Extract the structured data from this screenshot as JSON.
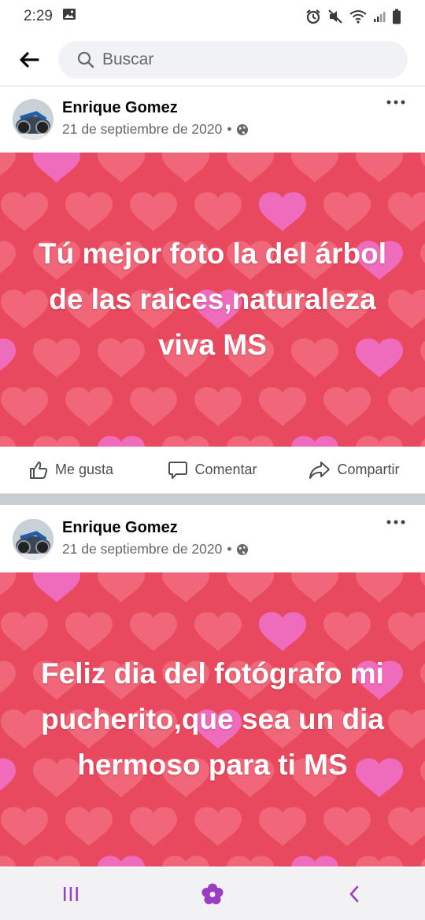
{
  "status_bar": {
    "time": "2:29",
    "icons": [
      "image-icon",
      "alarm-icon",
      "mute-icon",
      "wifi-icon",
      "signal-icon",
      "battery-icon"
    ]
  },
  "search": {
    "placeholder": "Buscar"
  },
  "posts": [
    {
      "author": "Enrique Gomez",
      "date": "21 de septiembre de 2020",
      "separator": "•",
      "privacy_icon": "globe-icon",
      "text": "Tú mejor foto la del árbol de las raices,naturaleza viva MS"
    },
    {
      "author": "Enrique Gomez",
      "date": "21 de septiembre de 2020",
      "separator": "•",
      "privacy_icon": "globe-icon",
      "text": "Feliz dia del fotógrafo mi pucherito,que sea un dia hermoso para ti MS"
    }
  ],
  "actions": {
    "like": "Me gusta",
    "comment": "Comentar",
    "share": "Compartir"
  },
  "colors": {
    "background_red": "#e8495e",
    "heart_red": "#f17283",
    "heart_pink": "#f06fc7",
    "separator": "#c9ccd1",
    "nav_icon": "#9b3cc2"
  },
  "nav": {
    "icons": [
      "recent-apps-icon",
      "home-icon",
      "back-icon"
    ]
  }
}
